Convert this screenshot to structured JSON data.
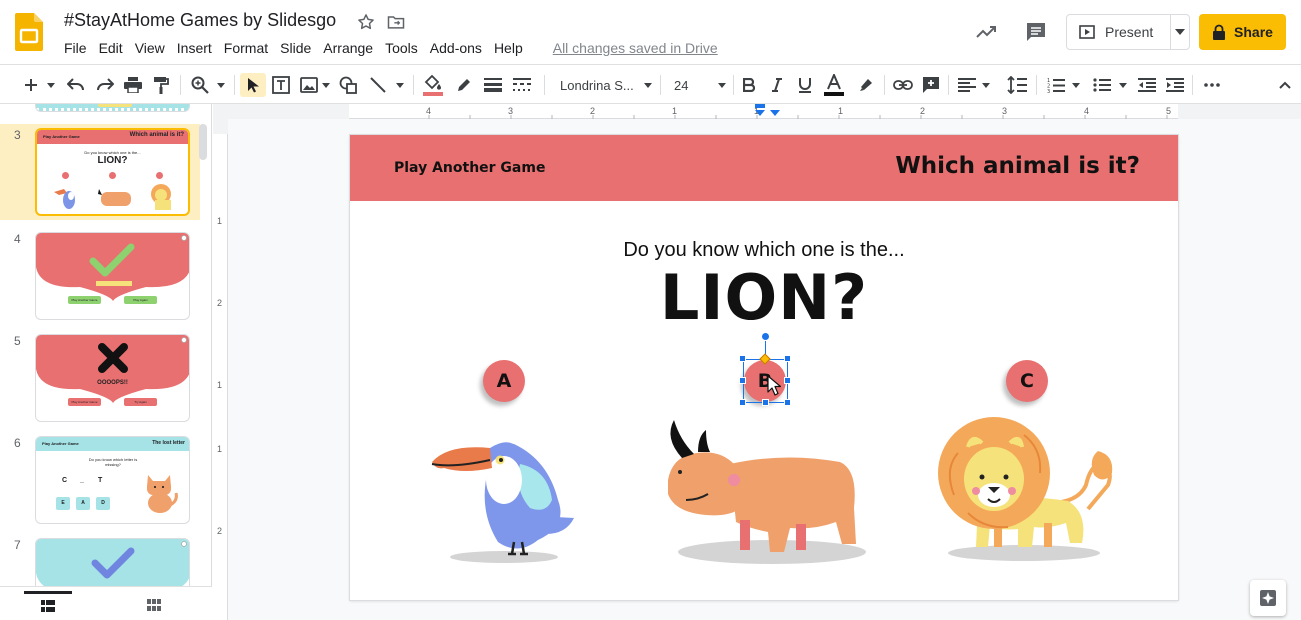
{
  "app": {
    "doc_title": "#StayAtHome Games by Slidesgo",
    "save_status": "All changes saved in Drive",
    "present_label": "Present",
    "share_label": "Share",
    "accent": "#fbbc04"
  },
  "menu": [
    "File",
    "Edit",
    "View",
    "Insert",
    "Format",
    "Slide",
    "Arrange",
    "Tools",
    "Add-ons",
    "Help"
  ],
  "toolbar": {
    "font_name": "Londrina S...",
    "font_size": "24"
  },
  "ruler": {
    "h_labels": [
      "4",
      "3",
      "2",
      "1",
      "1",
      "1",
      "2",
      "3",
      "4",
      "5"
    ],
    "v_labels": [
      "1",
      "2",
      "1",
      "1",
      "2"
    ]
  },
  "filmstrip": {
    "slides": [
      {
        "num": "3",
        "selected": true,
        "title_left": "Play Another Game",
        "title_right": "Which animal is it?",
        "line1": "Do you know which one is the...",
        "line2": "LION?"
      },
      {
        "num": "4",
        "selected": false,
        "btn1": "Play Another Game",
        "btn2": "Play Again"
      },
      {
        "num": "5",
        "selected": false,
        "word": "OOOOPS!!",
        "btn1": "Play Another Game",
        "btn2": "Try Again"
      },
      {
        "num": "6",
        "selected": false,
        "title_left": "Play Another Game",
        "title_right": "The lost letter",
        "line1": "Do you know which letter is missing?",
        "letters": [
          "C",
          "_",
          "T"
        ],
        "choices": [
          "E",
          "A",
          "D"
        ]
      },
      {
        "num": "7",
        "selected": false
      }
    ]
  },
  "slide": {
    "banner_left": "Play Another Game",
    "banner_right": "Which animal is it?",
    "question": "Do you know which one is the...",
    "big_question": "LION?",
    "options": [
      "A",
      "B",
      "C"
    ],
    "banner_color": "#e87070"
  }
}
